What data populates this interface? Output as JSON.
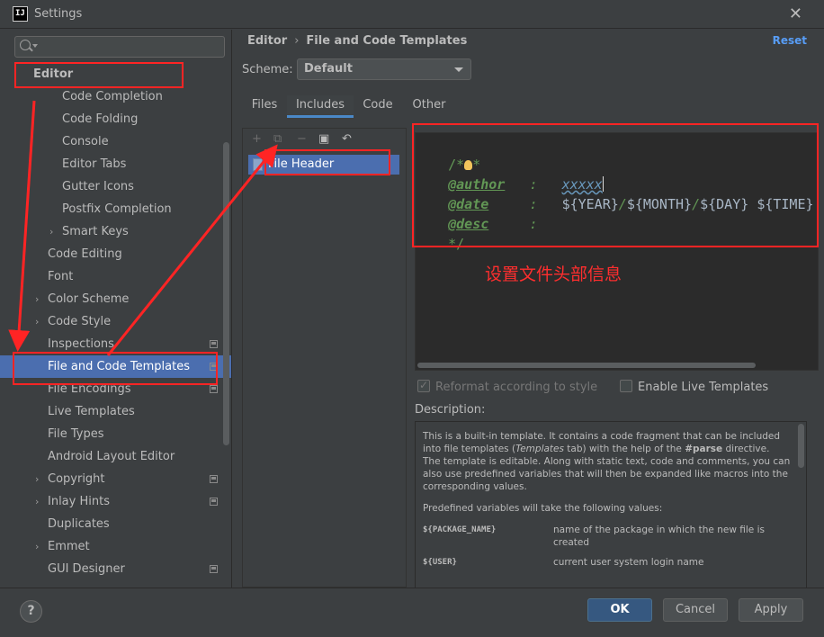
{
  "window": {
    "title": "Settings",
    "app_icon_text": "IJ",
    "close_icon": "close-icon"
  },
  "search": {
    "placeholder": "Q·"
  },
  "nav": {
    "items": [
      {
        "label": "Editor",
        "level": 0,
        "expandable": false,
        "project": false
      },
      {
        "label": "Code Completion",
        "level": 2,
        "expandable": false,
        "project": false
      },
      {
        "label": "Code Folding",
        "level": 2,
        "expandable": false,
        "project": false
      },
      {
        "label": "Console",
        "level": 2,
        "expandable": false,
        "project": false
      },
      {
        "label": "Editor Tabs",
        "level": 2,
        "expandable": false,
        "project": false
      },
      {
        "label": "Gutter Icons",
        "level": 2,
        "expandable": false,
        "project": false
      },
      {
        "label": "Postfix Completion",
        "level": 2,
        "expandable": false,
        "project": false
      },
      {
        "label": "Smart Keys",
        "level": 2,
        "expandable": true,
        "project": false
      },
      {
        "label": "Code Editing",
        "level": 1,
        "expandable": false,
        "project": false
      },
      {
        "label": "Font",
        "level": 1,
        "expandable": false,
        "project": false
      },
      {
        "label": "Color Scheme",
        "level": 1,
        "expandable": true,
        "project": false
      },
      {
        "label": "Code Style",
        "level": 1,
        "expandable": true,
        "project": false
      },
      {
        "label": "Inspections",
        "level": 1,
        "expandable": false,
        "project": true
      },
      {
        "label": "File and Code Templates",
        "level": 1,
        "expandable": false,
        "project": true,
        "selected": true
      },
      {
        "label": "File Encodings",
        "level": 1,
        "expandable": false,
        "project": true
      },
      {
        "label": "Live Templates",
        "level": 1,
        "expandable": false,
        "project": false
      },
      {
        "label": "File Types",
        "level": 1,
        "expandable": false,
        "project": false
      },
      {
        "label": "Android Layout Editor",
        "level": 1,
        "expandable": false,
        "project": false
      },
      {
        "label": "Copyright",
        "level": 1,
        "expandable": true,
        "project": true
      },
      {
        "label": "Inlay Hints",
        "level": 1,
        "expandable": true,
        "project": true
      },
      {
        "label": "Duplicates",
        "level": 1,
        "expandable": false,
        "project": false
      },
      {
        "label": "Emmet",
        "level": 1,
        "expandable": true,
        "project": false
      },
      {
        "label": "GUI Designer",
        "level": 1,
        "expandable": false,
        "project": true
      }
    ]
  },
  "header": {
    "breadcrumb_root": "Editor",
    "breadcrumb_sep": "›",
    "breadcrumb_page": "File and Code Templates",
    "reset_label": "Reset"
  },
  "scheme": {
    "label": "Scheme:",
    "value": "Default"
  },
  "tabs": [
    {
      "label": "Files",
      "active": false
    },
    {
      "label": "Includes",
      "active": true
    },
    {
      "label": "Code",
      "active": false
    },
    {
      "label": "Other",
      "active": false
    }
  ],
  "templates": {
    "toolbar": [
      "+",
      "⧉",
      "−",
      "▣",
      "↶"
    ],
    "items": [
      "File Header"
    ]
  },
  "editor": {
    "line1_open": "/*",
    "line1_star": "*",
    "author_tag": "@author",
    "author_colon": ":",
    "author_value": "xxxxx",
    "date_tag": "@date",
    "date_colon": ":",
    "date_value_year": "${YEAR}",
    "date_value_slash1": "/",
    "date_value_month": "${MONTH}",
    "date_value_slash2": "/",
    "date_value_day": "${DAY}",
    "date_value_time": "${TIME}",
    "desc_tag": "@desc",
    "desc_colon": ":",
    "close": "*/"
  },
  "annotation": {
    "text": "设置文件头部信息",
    "color": "#ff2e2e"
  },
  "options": {
    "reformat_label": "Reformat according to style",
    "reformat_checked": true,
    "live_templates_label": "Enable Live Templates",
    "live_templates_checked": false
  },
  "description": {
    "label": "Description:",
    "p1_a": "This is a built-in template. It contains a code fragment that can be included into file templates (",
    "p1_em": "Templates",
    "p1_b": " tab) with the help of the ",
    "p1_strong": "#parse",
    "p1_c": " directive.",
    "p2": "The template is editable. Along with static text, code and comments, you can also use predefined variables that will then be expanded like macros into the corresponding values.",
    "p3": "Predefined variables will take the following values:",
    "vars": [
      {
        "name": "${PACKAGE_NAME}",
        "desc": "name of the package in which the new file is created"
      },
      {
        "name": "${USER}",
        "desc": "current user system login name"
      }
    ]
  },
  "buttons": {
    "help": "?",
    "ok": "OK",
    "cancel": "Cancel",
    "apply": "Apply"
  },
  "colors": {
    "accent": "#4b6eaf",
    "link": "#589df6",
    "annotation_red": "#ff2424"
  }
}
